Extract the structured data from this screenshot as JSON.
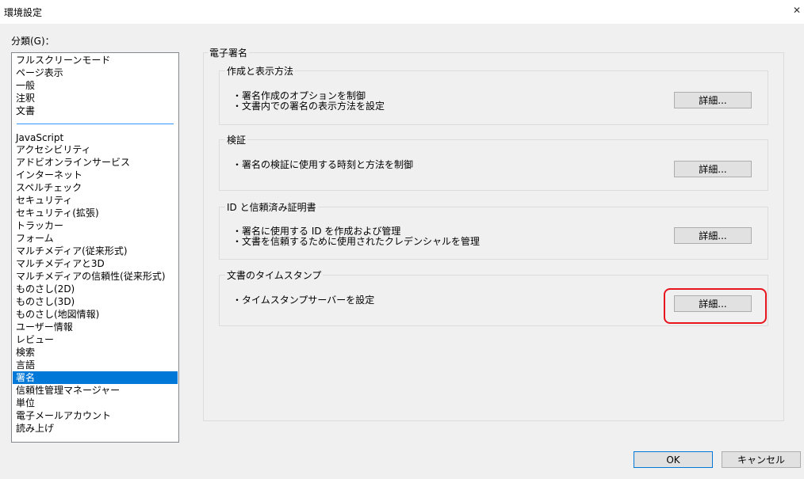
{
  "window": {
    "title": "環境設定"
  },
  "category": {
    "label": "分類(G)：",
    "items": [
      "フルスクリーンモード",
      "ページ表示",
      "一般",
      "注釈",
      "文書",
      "JavaScript",
      "アクセシビリティ",
      "アドビオンラインサービス",
      "インターネット",
      "スペルチェック",
      "セキュリティ",
      "セキュリティ(拡張)",
      "トラッカー",
      "フォーム",
      "マルチメディア(従来形式)",
      "マルチメディアと3D",
      "マルチメディアの信頼性(従来形式)",
      "ものさし(2D)",
      "ものさし(3D)",
      "ものさし(地図情報)",
      "ユーザー情報",
      "レビュー",
      "検索",
      "言語",
      "署名",
      "信頼性管理マネージャー",
      "単位",
      "電子メールアカウント",
      "読み上げ"
    ],
    "selected": "署名"
  },
  "signature": {
    "title": "電子署名",
    "sections": [
      {
        "title": "作成と表示方法",
        "lines": [
          "・署名作成のオプションを制御",
          "・文書内での署名の表示方法を設定"
        ],
        "button": "詳細..."
      },
      {
        "title": "検証",
        "lines": [
          "・署名の検証に使用する時刻と方法を制御"
        ],
        "button": "詳細..."
      },
      {
        "title": "ID と信頼済み証明書",
        "lines": [
          "・署名に使用する ID を作成および管理",
          "・文書を信頼するために使用されたクレデンシャルを管理"
        ],
        "button": "詳細..."
      },
      {
        "title": "文書のタイムスタンプ",
        "lines": [
          "・タイムスタンプサーバーを設定"
        ],
        "button": "詳細..."
      }
    ]
  },
  "footer": {
    "ok": "OK",
    "cancel": "キャンセル"
  },
  "colors": {
    "selection": "#0078d7",
    "highlight": "#e8141e"
  },
  "icons": {
    "close": "close-icon"
  }
}
